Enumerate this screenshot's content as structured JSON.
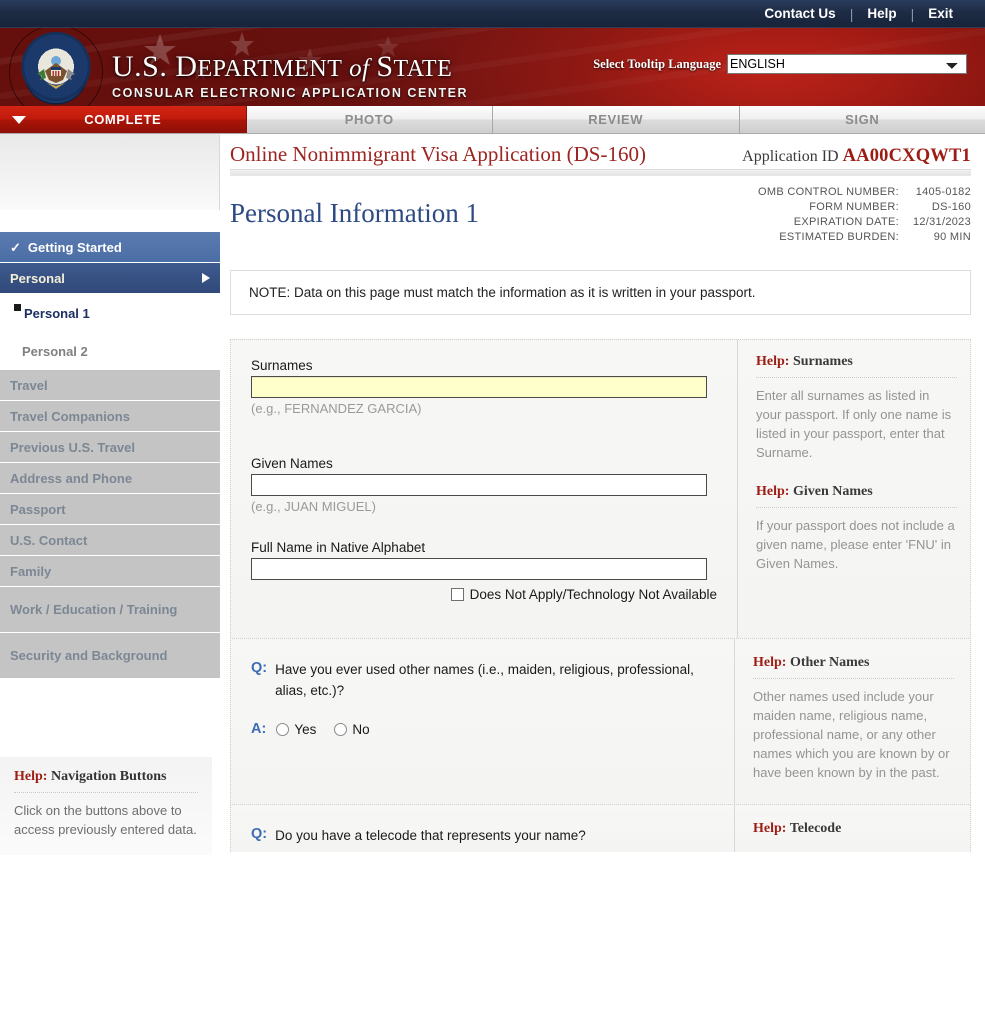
{
  "utility": {
    "links": [
      {
        "label": "Contact Us",
        "name": "contact-us-link"
      },
      {
        "label": "Help",
        "name": "help-link"
      },
      {
        "label": "Exit",
        "name": "exit-link"
      }
    ],
    "separator": "|"
  },
  "banner": {
    "dept_line1_a": "U.S. D",
    "dept_line1_b": "EPARTMENT",
    "dept_line1_of": " of ",
    "dept_line1_c": "S",
    "dept_line1_d": "TATE",
    "subtitle": "CONSULAR ELECTRONIC APPLICATION CENTER",
    "tooltip_label": "Select Tooltip Language",
    "tooltip_value": "ENGLISH",
    "tooltip_options": [
      "ENGLISH"
    ],
    "seal_name": "us-department-of-state-seal"
  },
  "tabs": [
    {
      "label": "COMPLETE",
      "active": true
    },
    {
      "label": "PHOTO",
      "active": false
    },
    {
      "label": "REVIEW",
      "active": false
    },
    {
      "label": "SIGN",
      "active": false
    }
  ],
  "sidebar": {
    "nav": [
      {
        "label": "Getting Started",
        "state": "done"
      },
      {
        "label": "Personal",
        "state": "current"
      },
      {
        "label": "Travel",
        "state": "disabled"
      },
      {
        "label": "Travel Companions",
        "state": "disabled"
      },
      {
        "label": "Previous U.S. Travel",
        "state": "disabled"
      },
      {
        "label": "Address and Phone",
        "state": "disabled"
      },
      {
        "label": "Passport",
        "state": "disabled"
      },
      {
        "label": "U.S. Contact",
        "state": "disabled"
      },
      {
        "label": "Family",
        "state": "disabled"
      },
      {
        "label": "Work / Education / Training",
        "state": "disabled"
      },
      {
        "label": "Security and Background",
        "state": "disabled"
      }
    ],
    "subnav": [
      {
        "label": "Personal 1",
        "active": true
      },
      {
        "label": "Personal 2",
        "active": false
      }
    ],
    "help": {
      "title_word": "Help:",
      "title_rest": " Navigation Buttons",
      "body": "Click on the buttons above to access previously entered data."
    }
  },
  "content": {
    "app_title": "Online Nonimmigrant Visa Application (DS-160)",
    "application_id_label": "Application ID ",
    "application_id_value": "AA00CXQWT1",
    "page_title": "Personal Information 1",
    "meta": [
      {
        "label": "OMB CONTROL NUMBER:",
        "value": "1405-0182"
      },
      {
        "label": "FORM NUMBER:",
        "value": "DS-160"
      },
      {
        "label": "EXPIRATION DATE:",
        "value": "12/31/2023"
      },
      {
        "label": "ESTIMATED BURDEN:",
        "value": "90 MIN"
      }
    ],
    "note": "NOTE: Data on this page must match the information as it is written in your passport.",
    "fields": {
      "surnames": {
        "label": "Surnames",
        "value": "",
        "example": "(e.g., FERNANDEZ GARCIA)"
      },
      "given_names": {
        "label": "Given Names",
        "value": "",
        "example": "(e.g., JUAN MIGUEL)"
      },
      "native_alphabet": {
        "label": "Full Name in Native Alphabet",
        "value": "",
        "checkbox_label": "Does Not Apply/Technology Not Available"
      }
    },
    "help_panels": [
      {
        "title_word": "Help:",
        "title_rest": " Surnames",
        "body": "Enter all surnames as listed in your passport. If only one name is listed in your passport, enter that Surname."
      },
      {
        "title_word": "Help:",
        "title_rest": " Given Names",
        "body": "If your passport does not include a given name, please enter 'FNU' in Given Names."
      }
    ],
    "questions": [
      {
        "q_marker": "Q:",
        "a_marker": "A:",
        "text": "Have you ever used other names (i.e., maiden, religious, professional, alias, etc.)?",
        "options": [
          {
            "label": "Yes",
            "selected": false
          },
          {
            "label": "No",
            "selected": false
          }
        ],
        "help": {
          "title_word": "Help:",
          "title_rest": " Other Names",
          "body": "Other names used include your maiden name, religious name, professional name, or any other names which you are known by or have been known by in the past."
        }
      },
      {
        "q_marker": "Q:",
        "text": "Do you have a telecode that represents your name?",
        "help": {
          "title_word": "Help:",
          "title_rest": " Telecode",
          "body": ""
        }
      }
    ]
  },
  "colors": {
    "brand_red": "#9d1c14",
    "banner_red": "#b12018",
    "tab_active": "#c01b0c",
    "nav_current": "#31497a",
    "nav_done": "#4b6ea6",
    "required_field": "#ffffcc",
    "page_title_blue": "#2d4a82"
  }
}
